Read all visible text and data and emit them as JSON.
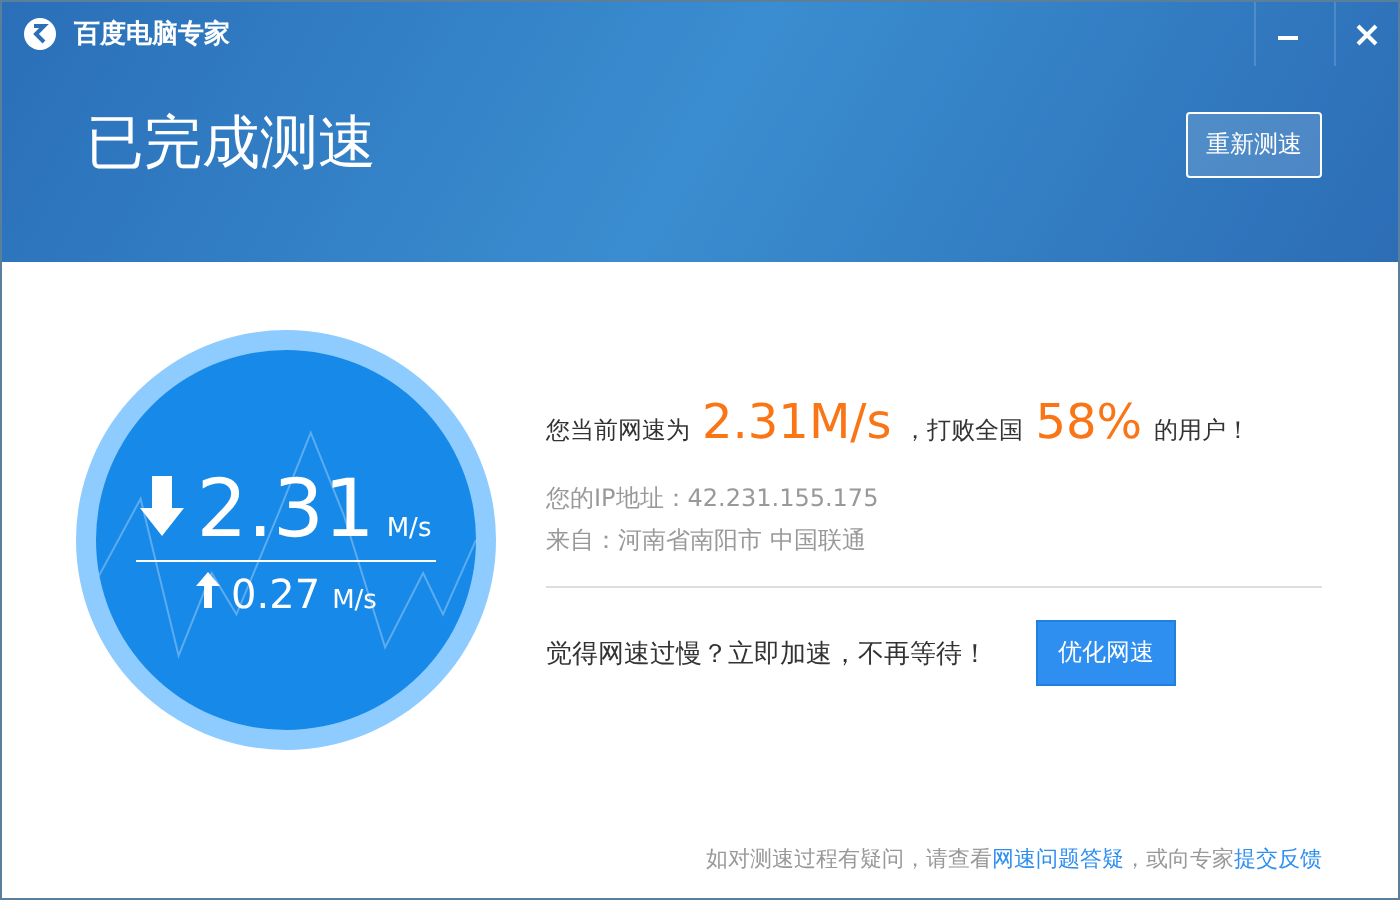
{
  "window": {
    "title": "百度电脑专家"
  },
  "header": {
    "heading": "已完成测速",
    "retest_button": "重新测速"
  },
  "gauge": {
    "download_value": "2.31",
    "download_unit": "M/s",
    "upload_value": "0.27",
    "upload_unit": "M/s"
  },
  "result": {
    "prefix": "您当前网速为",
    "speed": "2.31M/s",
    "middle": "，打败全国",
    "percent": "58%",
    "suffix": "的用户！"
  },
  "details": [
    "您的IP地址：42.231.155.175",
    "来自：河南省南阳市 中国联通"
  ],
  "boost": {
    "text": "觉得网速过慢？立即加速，不再等待！",
    "button": "优化网速"
  },
  "footer": {
    "text": "如对测速过程有疑问，请查看",
    "link1": "网速问题答疑",
    "middle": "，或向专家",
    "link2": "提交反馈"
  }
}
